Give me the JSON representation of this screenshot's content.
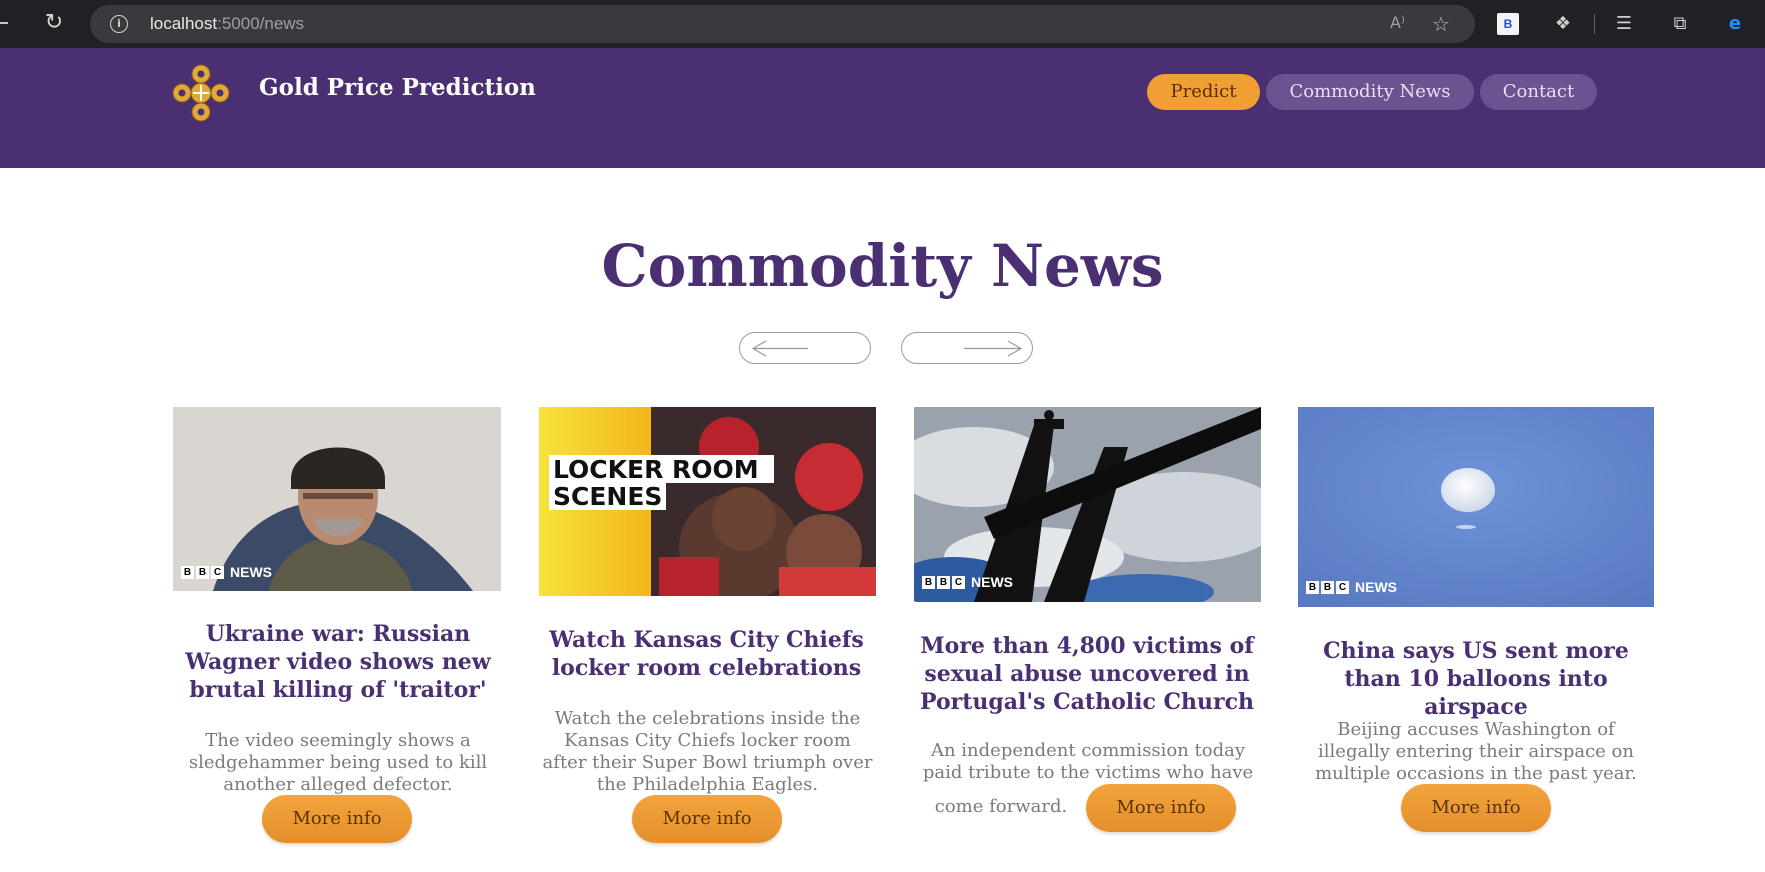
{
  "browser": {
    "url_host": "localhost",
    "url_rest": ":5000/news",
    "extension_badge": "B"
  },
  "header": {
    "brand": "Gold Price Prediction",
    "nav": [
      {
        "label": "Predict",
        "active": true
      },
      {
        "label": "Commodity News",
        "active": false
      },
      {
        "label": "Contact",
        "active": false
      }
    ]
  },
  "main": {
    "title": "Commodity News",
    "cards": [
      {
        "title": "Ukraine war: Russian Wagner video shows new brutal killing of 'traitor'",
        "description": "The video seemingly shows a sledgehammer being used to kill another alleged defector.",
        "button": "More info",
        "bbc_label": "NEWS"
      },
      {
        "title": "Watch Kansas City Chiefs locker room celebrations",
        "description": "Watch the celebrations inside the Kansas City Chiefs locker room after their Super Bowl triumph over the Philadelphia Eagles.",
        "button": "More info",
        "overlay_line1": "LOCKER ROOM",
        "overlay_line2": "SCENES"
      },
      {
        "title": "More than 4,800 victims of sexual abuse uncovered in Portugal's Catholic Church",
        "description_line1": "An independent commission today paid tribute to the victims who have",
        "description_line2": "come forward.",
        "button": "More info",
        "bbc_label": "NEWS"
      },
      {
        "title": "China says US sent more than 10 balloons into airspace",
        "description": "Beijing accuses Washington of illegally entering their airspace on multiple occasions in the past year.",
        "button": "More info",
        "bbc_label": "NEWS"
      }
    ]
  }
}
